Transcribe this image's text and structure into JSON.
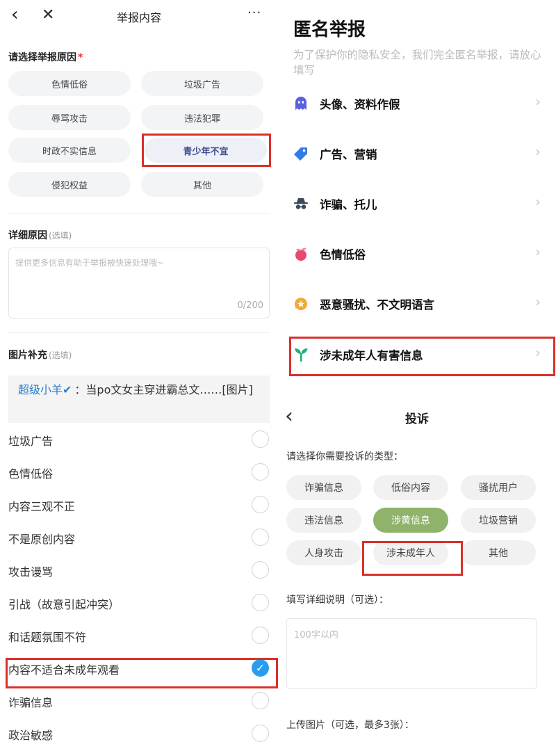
{
  "left": {
    "nav": {
      "back_icon": "‹",
      "close_icon": "✕",
      "title": "举报内容",
      "more_icon": "···"
    },
    "reason_section": {
      "title": "请选择举报原因",
      "required_mark": "*"
    },
    "reasons": [
      "色情低俗",
      "垃圾广告",
      "辱骂攻击",
      "违法犯罪",
      "时政不实信息",
      "青少年不宜",
      "侵犯权益",
      "其他"
    ],
    "selected_reason": "青少年不宜",
    "detail_section": {
      "title": "详细原因",
      "optional": "(选填)",
      "placeholder": "提供更多信息有助于举报被快速处理哦~",
      "counter": "0/200"
    },
    "image_section": {
      "title": "图片补充",
      "optional": "(选填)"
    },
    "quote": {
      "user": "超级小羊",
      "text": "：当po文女主穿进霸总文……[图片]"
    },
    "options": [
      {
        "label": "垃圾广告",
        "checked": false
      },
      {
        "label": "色情低俗",
        "checked": false
      },
      {
        "label": "内容三观不正",
        "checked": false
      },
      {
        "label": "不是原创内容",
        "checked": false
      },
      {
        "label": "攻击谩骂",
        "checked": false
      },
      {
        "label": "引战（故意引起冲突）",
        "checked": false
      },
      {
        "label": "和话题氛围不符",
        "checked": false
      },
      {
        "label": "内容不适合未成年观看",
        "checked": true
      },
      {
        "label": "诈骗信息",
        "checked": false
      },
      {
        "label": "政治敏感",
        "checked": false
      }
    ]
  },
  "right_top": {
    "title": "匿名举报",
    "subtitle": "为了保护你的隐私安全，我们完全匿名举报，请放心填写",
    "items": [
      {
        "label": "头像、资料作假",
        "icon": "ghost-icon",
        "color": "#5b5fe0"
      },
      {
        "label": "广告、营销",
        "icon": "tag-icon",
        "color": "#2f7be8"
      },
      {
        "label": "诈骗、托儿",
        "icon": "spy-icon",
        "color": "#3a4a5a"
      },
      {
        "label": "色情低俗",
        "icon": "peach-icon",
        "color": "#e84a6e"
      },
      {
        "label": "恶意骚扰、不文明语言",
        "icon": "star-bubble-icon",
        "color": "#f2a93b"
      },
      {
        "label": "涉未成年人有害信息",
        "icon": "sprout-icon",
        "color": "#22b07d"
      }
    ],
    "chevron": "›"
  },
  "right_bottom": {
    "back_icon": "‹",
    "title": "投诉",
    "type_prompt": "请选择你需要投诉的类型：",
    "tags": [
      "诈骗信息",
      "低俗内容",
      "骚扰用户",
      "违法信息",
      "涉黄信息",
      "垃圾营销",
      "人身攻击",
      "涉未成年人",
      "其他"
    ],
    "selected_tag": "涉黄信息",
    "detail_label": "填写详细说明（可选）：",
    "detail_placeholder": "100字以内",
    "upload_label": "上传图片（可选，最多3张）："
  },
  "colors": {
    "highlight": "#d9302a",
    "check": "#2a9cf0",
    "selected_tag": "#8fb36a",
    "user_link": "#2a7dc9"
  }
}
